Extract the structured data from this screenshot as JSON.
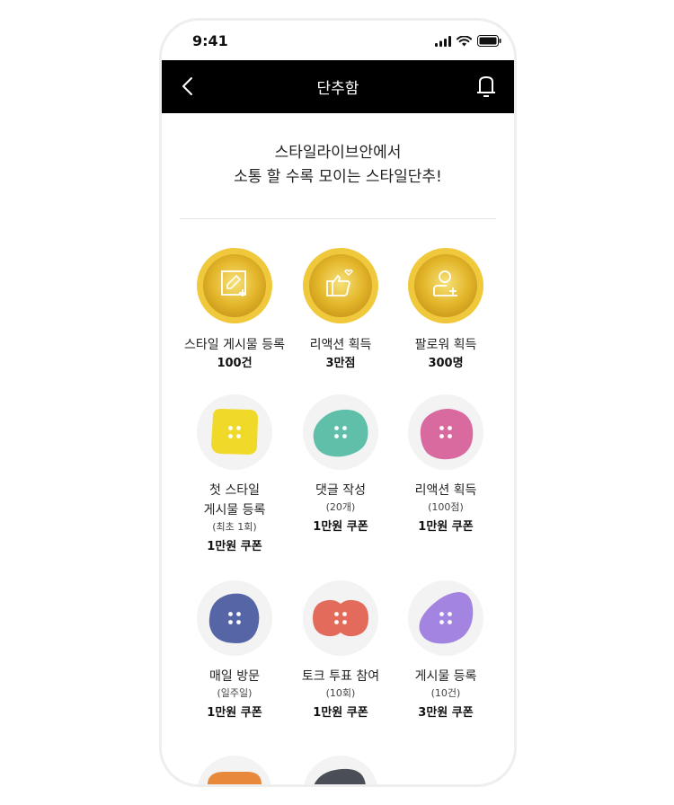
{
  "status_bar": {
    "time": "9:41"
  },
  "nav": {
    "title": "단추함"
  },
  "headline": {
    "line1": "스타일라이브안에서",
    "line2": "소통 할 수록 모이는 스타일단추!"
  },
  "achievements": [
    {
      "title": "스타일 게시물 등록",
      "reward": "100건",
      "icon": "edit-image-icon"
    },
    {
      "title": "리액션 획득",
      "reward": "3만점",
      "icon": "thumbs-up-icon"
    },
    {
      "title": "팔로워 획득",
      "reward": "300명",
      "icon": "add-person-icon"
    }
  ],
  "missions": [
    {
      "title1": "첫 스타일",
      "title2": "게시물 등록",
      "sub": "(최초 1회)",
      "reward": "1만원 쿠폰",
      "color": "#f1d92a"
    },
    {
      "title1": "댓글 작성",
      "title2": "",
      "sub": "(20개)",
      "reward": "1만원 쿠폰",
      "color": "#5fbfa9"
    },
    {
      "title1": "리액션 획득",
      "title2": "",
      "sub": "(100점)",
      "reward": "1만원 쿠폰",
      "color": "#d86aa0"
    },
    {
      "title1": "매일 방문",
      "title2": "",
      "sub": "(일주일)",
      "reward": "1만원 쿠폰",
      "color": "#5565a6"
    },
    {
      "title1": "토크 투표 참여",
      "title2": "",
      "sub": "(10회)",
      "reward": "1만원 쿠폰",
      "color": "#e26b5c"
    },
    {
      "title1": "게시물 등록",
      "title2": "",
      "sub": "(10건)",
      "reward": "3만원 쿠폰",
      "color": "#a384e0"
    },
    {
      "title1": "",
      "title2": "",
      "sub": "",
      "reward": "",
      "color": "#e8883a"
    },
    {
      "title1": "",
      "title2": "",
      "sub": "",
      "reward": "",
      "color": "#4a4e56"
    }
  ]
}
